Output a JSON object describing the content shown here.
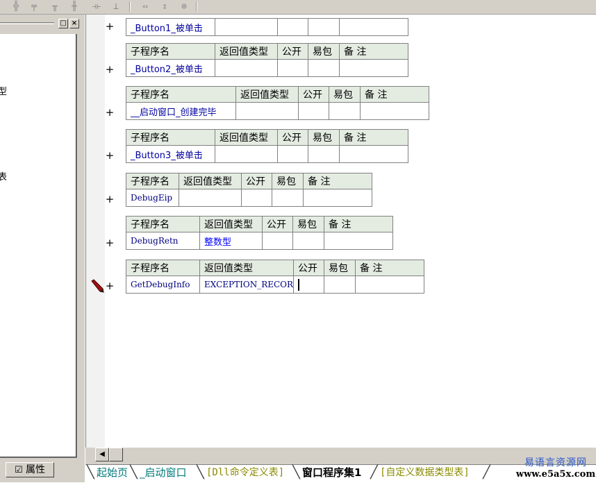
{
  "toolbar": {
    "icons": [
      "align-left-icon",
      "align-center-icon",
      "align-top-icon",
      "align-middle-icon",
      "same-width-icon",
      "same-height-icon",
      "space-horizontal-icon",
      "space-vertical-icon",
      "center-icon"
    ]
  },
  "left_panel": {
    "pin_label": "□",
    "close_label": "×",
    "tree_clip_1": "型",
    "tree_clip_2": "表",
    "property_tab_label": "属性"
  },
  "header_labels": {
    "name": "子程序名",
    "return_type": "返回值类型",
    "public": "公开",
    "easy_pack": "易包",
    "remark": "备 注"
  },
  "subroutines": [
    {
      "name": "_Button1_被单击",
      "return_type": "",
      "show_header": false
    },
    {
      "name": "_Button2_被单击",
      "return_type": "",
      "show_header": true
    },
    {
      "name": "__启动窗口_创建完毕",
      "return_type": "",
      "show_header": true
    },
    {
      "name": "_Button3_被单击",
      "return_type": "",
      "show_header": true
    },
    {
      "name": "DebugEip",
      "return_type": "",
      "show_header": true
    },
    {
      "name": "DebugRetn",
      "return_type": "整数型",
      "show_header": true
    },
    {
      "name": "GetDebugInfo",
      "return_type": "EXCEPTION_RECORD",
      "show_header": true
    }
  ],
  "expand_symbol": "+",
  "tabs": [
    {
      "label": "起始页",
      "style": "teal"
    },
    {
      "label": "_启动窗口",
      "style": "teal"
    },
    {
      "label": "[Dll命令定义表]",
      "style": "olive"
    },
    {
      "label": "窗口程序集1",
      "style": "active"
    },
    {
      "label": "[自定义数据类型表]",
      "style": "olive"
    }
  ],
  "watermark": {
    "cn": "易语言资源网",
    "url": "www.e5a5x.com"
  },
  "colors": {
    "header_bg": "#e4ece2",
    "name_text": "#0000a0",
    "type_text": "#0000ff",
    "panel_bg": "#d4d0c8"
  }
}
